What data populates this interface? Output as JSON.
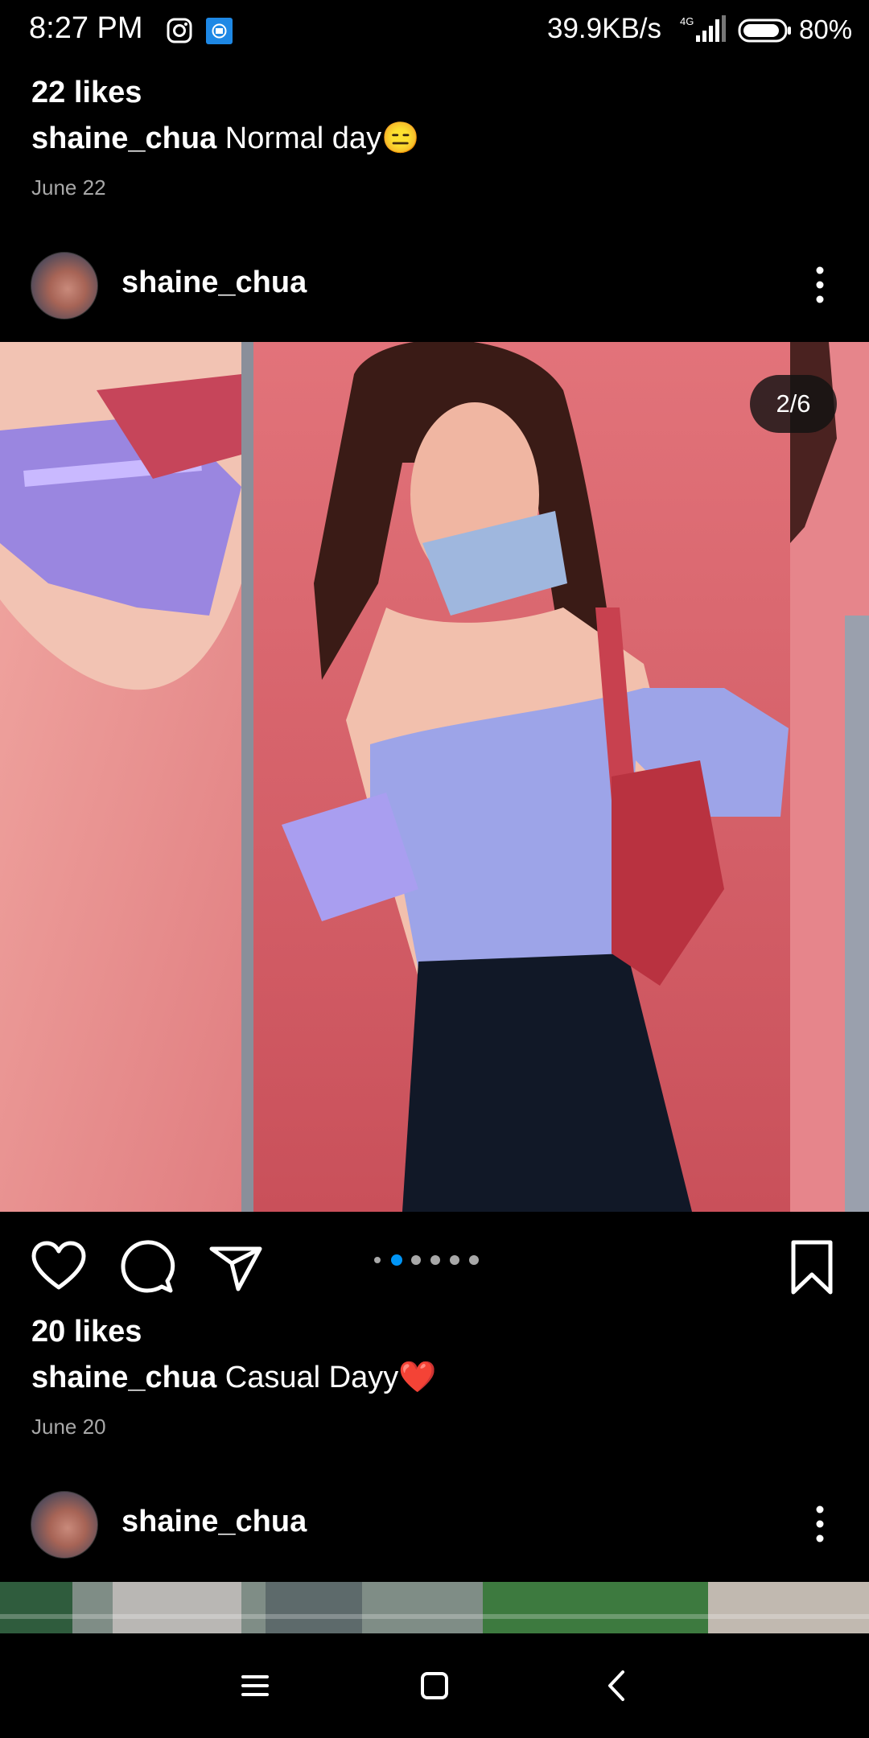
{
  "status_bar": {
    "time": "8:27 PM",
    "network_speed": "39.9KB/s",
    "network_type": "4G",
    "battery": "80%",
    "icons": [
      "instagram-icon",
      "app-notification-icon",
      "signal-icon",
      "battery-icon"
    ]
  },
  "previous_post": {
    "likes": "22 likes",
    "username": "shaine_chua",
    "caption": "Normal day😑",
    "date": "June 22"
  },
  "post": {
    "username": "shaine_chua",
    "image_counter": "2/6",
    "carousel": {
      "total": 6,
      "current": 2
    },
    "likes": "20 likes",
    "caption_username": "shaine_chua",
    "caption": "Casual Dayy❤️",
    "date": "June 20",
    "actions": [
      "like-icon",
      "comment-icon",
      "share-icon",
      "save-icon"
    ]
  },
  "next_post": {
    "username": "shaine_chua"
  },
  "nav_bar": {
    "buttons": [
      "menu-icon",
      "home-icon",
      "back-icon"
    ]
  },
  "colors": {
    "background": "#000000",
    "accent_blue": "#0095f6",
    "secondary_text": "#a8a8a8",
    "image_wall_pink": "#d55f66"
  }
}
